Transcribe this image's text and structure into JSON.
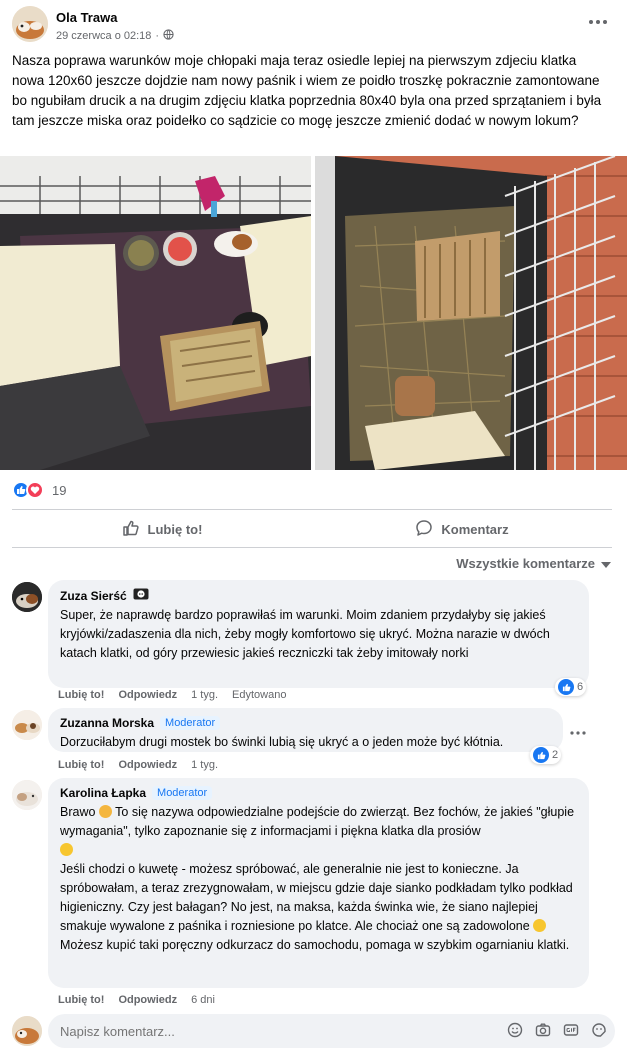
{
  "post": {
    "author": "Ola Trawa",
    "date": "29 czerwca o 02:18",
    "separator": "·",
    "text": "Nasza poprawa warunków moje chłopaki maja teraz osiedle lepiej na pierwszym zdjeciu klatka nowa 120x60 jeszcze dojdzie nam nowy paśnik i wiem ze poidło troszkę pokracznie zamontowane bo ngubiłam drucik a na drugim zdjęciu klatka poprzednia 80x40 byla ona przed sprzątaniem i była tam jeszcze miska oraz poidełko co sądzicie co mogę jeszcze zmienić dodać w nowym lokum?",
    "reaction_count": "19",
    "like_label": "Lubię to!",
    "comment_label": "Komentarz",
    "sort_label": "Wszystkie komentarze"
  },
  "comments": [
    {
      "name": "Zuza Sierść",
      "badge": "",
      "text": "Super, że naprawdę bardzo poprawiłaś im warunki. Moim zdaniem przydałyby się jakieś kryjówki/zadaszenia dla nich, żeby mogły komfortowo się ukryć. Można narazie w dwóch katach klatki, od góry przewiesic jakieś reczniczki tak żeby imitowały norki",
      "like": "Lubię to!",
      "reply": "Odpowiedz",
      "time": "1 tyg.",
      "edited": "Edytowano",
      "reactions": "6"
    },
    {
      "name": "Zuzanna Morska",
      "badge": "Moderator",
      "text": "Dorzuciłabym drugi mostek bo świnki lubią się ukryć a o jeden może być kłótnia.",
      "like": "Lubię to!",
      "reply": "Odpowiedz",
      "time": "1 tyg.",
      "reactions": "2"
    },
    {
      "name": "Karolina Łapka",
      "badge": "Moderator",
      "p1a": "Brawo",
      "p1b": "To się nazywa odpowiedzialne podejście do zwierząt. Bez fochów, że jakieś \"głupie wymagania\", tylko zapoznanie się z informacjami i piękna klatka dla prosiów",
      "p2a": "Jeśli chodzi o kuwetę - możesz spróbować, ale generalnie nie jest to konieczne. Ja spróbowałam, a teraz zrezygnowałam, w miejscu gdzie daje sianko podkładam tylko podkład higieniczny. Czy jest bałagan? No jest, na maksa, każda świnka wie, że siano najlepiej smakuje wywalone z paśnika i rozniesione po klatce. Ale chociaż one są zadowolone",
      "p3": "Możesz kupić taki poręczny odkurzacz do samochodu, pomaga w szybkim ogarnianiu klatki.",
      "like": "Lubię to!",
      "reply": "Odpowiedz",
      "time": "6 dni"
    }
  ],
  "composer": {
    "placeholder": "Napisz komentarz..."
  },
  "colors": {
    "accent": "#1877f2",
    "love": "#f33e58",
    "secondary_text": "#65676b",
    "bubble": "#f0f2f5"
  },
  "icons": [
    "globe-icon",
    "more-icon",
    "like-icon",
    "love-icon",
    "thumb-up-icon",
    "comment-icon",
    "chevron-down-icon",
    "emoji-icon",
    "camera-icon",
    "gif-icon",
    "sticker-icon"
  ]
}
